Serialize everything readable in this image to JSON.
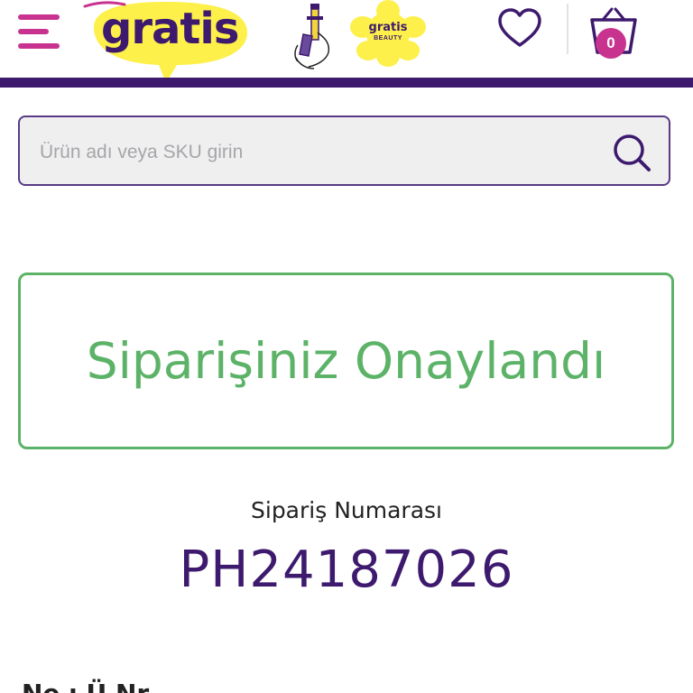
{
  "header": {
    "logo_text": "gratis",
    "beauty_badge": {
      "title": "gratis",
      "subtitle": "BEAUTY"
    },
    "cart_count": "0",
    "icons": [
      "menu-icon",
      "heart-icon",
      "basket-icon",
      "campaign-figure-icon"
    ],
    "colors": {
      "brand_purple": "#3d1a6e",
      "brand_pink": "#c8338f",
      "brand_yellow": "#fdf04a"
    }
  },
  "search": {
    "placeholder": "Ürün adı veya SKU girin",
    "value": "",
    "icon": "search-icon"
  },
  "confirmation": {
    "title": "Siparişiniz Onaylandı",
    "order_label": "Sipariş Numarası",
    "order_number": "PH24187026",
    "success_color": "#5cb368"
  },
  "next_section": {
    "title": "Ne   ı  Ü   Nr  "
  }
}
